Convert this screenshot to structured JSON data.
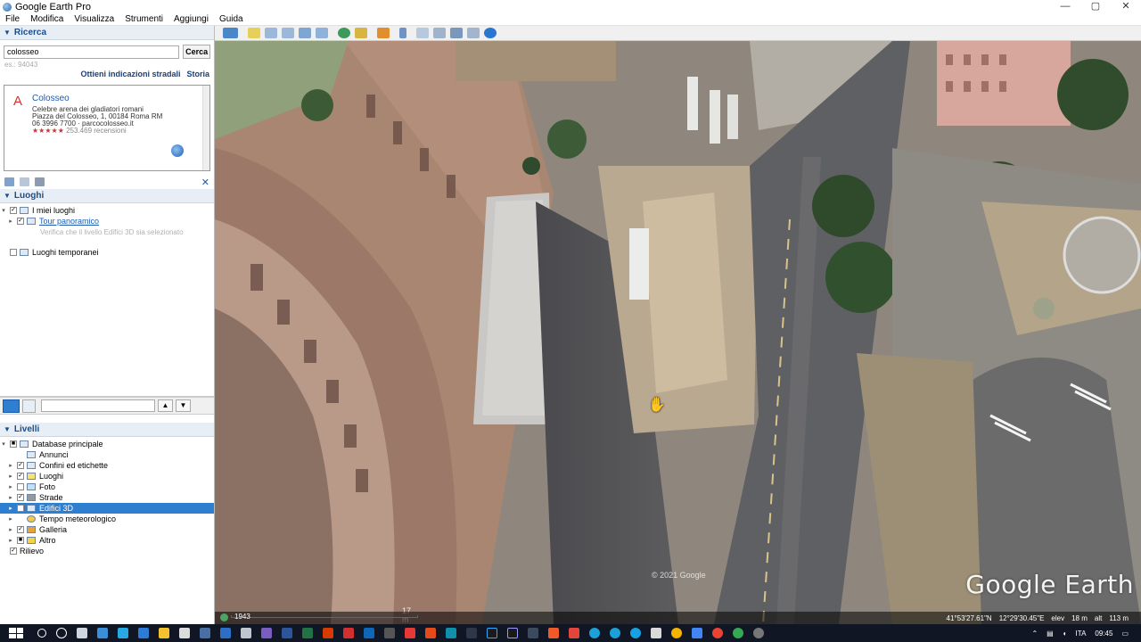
{
  "window": {
    "title": "Google Earth Pro",
    "controls": {
      "minimize": "—",
      "maximize": "▢",
      "close": "✕"
    }
  },
  "menu": [
    "File",
    "Modifica",
    "Visualizza",
    "Strumenti",
    "Aggiungi",
    "Guida"
  ],
  "search": {
    "header": "Ricerca",
    "value": "colosseo",
    "button": "Cerca",
    "hint": "es.: 94043",
    "directions_link": "Ottieni indicazioni stradali",
    "history_link": "Storia",
    "result": {
      "marker": "A",
      "name": "Colosseo",
      "description": "Celebre arena dei gladiatori romani",
      "address": "Piazza del Colosseo, 1, 00184 Roma RM",
      "phone_site": "06 3996 7700 · parcocolosseo.it",
      "stars": "★★★★★",
      "reviews": "253.469 recensioni"
    }
  },
  "places": {
    "header": "Luoghi",
    "my_places": "I miei luoghi",
    "tour": "Tour panoramico",
    "tour_note": "Verifica che il livello Edifici 3D sia selezionato",
    "temporary": "Luoghi temporanei"
  },
  "layers": {
    "header": "Livelli",
    "items": [
      {
        "label": "Database principale",
        "level": 0
      },
      {
        "label": "Annunci",
        "level": 1
      },
      {
        "label": "Confini ed etichette",
        "level": 1
      },
      {
        "label": "Luoghi",
        "level": 1
      },
      {
        "label": "Foto",
        "level": 1
      },
      {
        "label": "Strade",
        "level": 1
      },
      {
        "label": "Edifici 3D",
        "level": 1,
        "selected": true
      },
      {
        "label": "Tempo meteorologico",
        "level": 1
      },
      {
        "label": "Galleria",
        "level": 1
      },
      {
        "label": "Altro",
        "level": 1
      },
      {
        "label": "Rilievo",
        "level": 0
      }
    ]
  },
  "map": {
    "brand": "Google Earth",
    "copyright": "© 2021 Google",
    "scale": "17 m",
    "status": {
      "history": "1943",
      "lat": "41°53'27.61\"N",
      "lon": "12°29'30.45\"E",
      "elev_label": "elev",
      "elev": "18 m",
      "alt_label": "alt",
      "alt": "113 m"
    }
  },
  "taskbar": {
    "lang": "ITA",
    "time": "09:45"
  },
  "colors": {
    "accent": "#2f7fd1",
    "panel_header": "#1a4d8c",
    "taskbar": "#101624"
  }
}
